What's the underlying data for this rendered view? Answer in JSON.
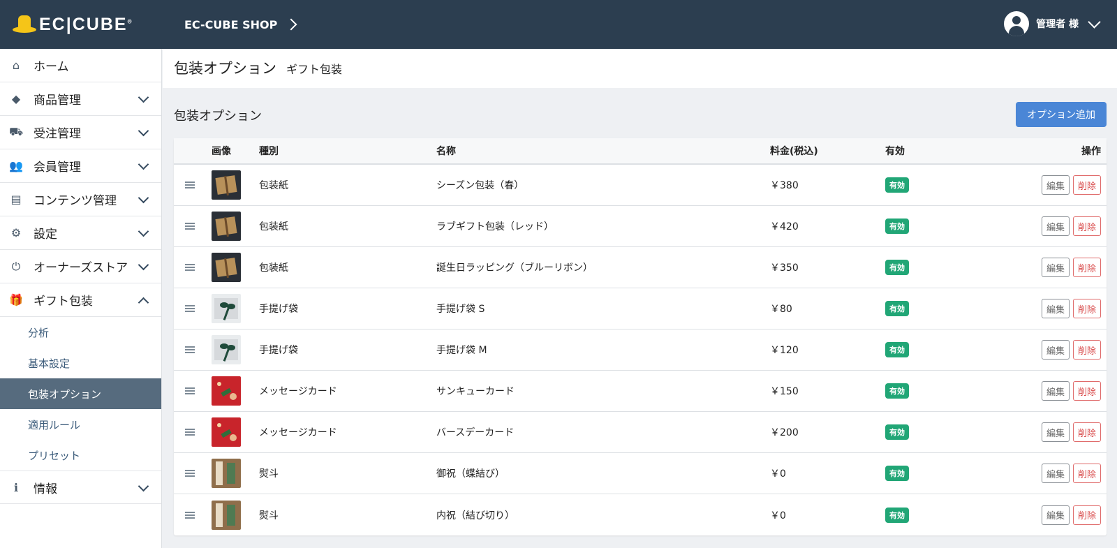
{
  "header": {
    "logo_text": "EC",
    "logo_text2": "CUBE",
    "shop_name": "EC-CUBE SHOP",
    "user_name": "管理者 様",
    "icons": {
      "logo": "hat-logo",
      "shop_chevron": "chevron-right-icon",
      "user": "user-circle-icon",
      "user_chevron": "chevron-down-icon"
    }
  },
  "sidebar": {
    "items": [
      {
        "label": "ホーム",
        "icon": "home-icon",
        "glyph": "⌂"
      },
      {
        "label": "商品管理",
        "icon": "box-icon",
        "glyph": "◆"
      },
      {
        "label": "受注管理",
        "icon": "cart-icon",
        "glyph": "⛟"
      },
      {
        "label": "会員管理",
        "icon": "users-icon",
        "glyph": "👥"
      },
      {
        "label": "コンテンツ管理",
        "icon": "file-icon",
        "glyph": "▤"
      },
      {
        "label": "設定",
        "icon": "gear-icon",
        "glyph": "⚙"
      },
      {
        "label": "オーナーズストア",
        "icon": "plug-icon",
        "glyph": "⏻"
      },
      {
        "label": "ギフト包装",
        "icon": "gift-icon",
        "glyph": "🎁"
      },
      {
        "label": "情報",
        "icon": "info-icon",
        "glyph": "ℹ"
      }
    ],
    "sub_items": [
      "分析",
      "基本設定",
      "包装オプション",
      "適用ルール",
      "プリセット"
    ],
    "active_sub": "包装オプション"
  },
  "main": {
    "title": "包装オプション",
    "subtitle": "ギフト包装",
    "section_title": "包装オプション",
    "add_button": "オプション追加",
    "columns": [
      "画像",
      "種別",
      "名称",
      "料金(税込)",
      "有効",
      "操作"
    ],
    "rows": [
      {
        "image": "kraft",
        "type": "包装紙",
        "name": "シーズン包装（春）",
        "price": "￥380",
        "status": "有効"
      },
      {
        "image": "kraft",
        "type": "包装紙",
        "name": "ラブギフト包装（レッド）",
        "price": "￥420",
        "status": "有効"
      },
      {
        "image": "kraft",
        "type": "包装紙",
        "name": "誕生日ラッピング（ブルーリボン）",
        "price": "￥350",
        "status": "有効"
      },
      {
        "image": "bag",
        "type": "手提げ袋",
        "name": "手提げ袋 S",
        "price": "￥80",
        "status": "有効"
      },
      {
        "image": "bag",
        "type": "手提げ袋",
        "name": "手提げ袋 M",
        "price": "￥120",
        "status": "有効"
      },
      {
        "image": "card",
        "type": "メッセージカード",
        "name": "サンキューカード",
        "price": "￥150",
        "status": "有効"
      },
      {
        "image": "card",
        "type": "メッセージカード",
        "name": "バースデーカード",
        "price": "￥200",
        "status": "有効"
      },
      {
        "image": "noshi",
        "type": "熨斗",
        "name": "御祝（蝶結び）",
        "price": "￥0",
        "status": "有効"
      },
      {
        "image": "noshi",
        "type": "熨斗",
        "name": "内祝（結び切り）",
        "price": "￥0",
        "status": "有効"
      }
    ],
    "edit_label": "編集",
    "delete_label": "削除"
  },
  "colors": {
    "header_bg": "#2c3e50",
    "accent": "#4a86d6",
    "active_badge": "#21a676",
    "delete": "#d84848",
    "active_sub_bg": "#566b7e"
  }
}
